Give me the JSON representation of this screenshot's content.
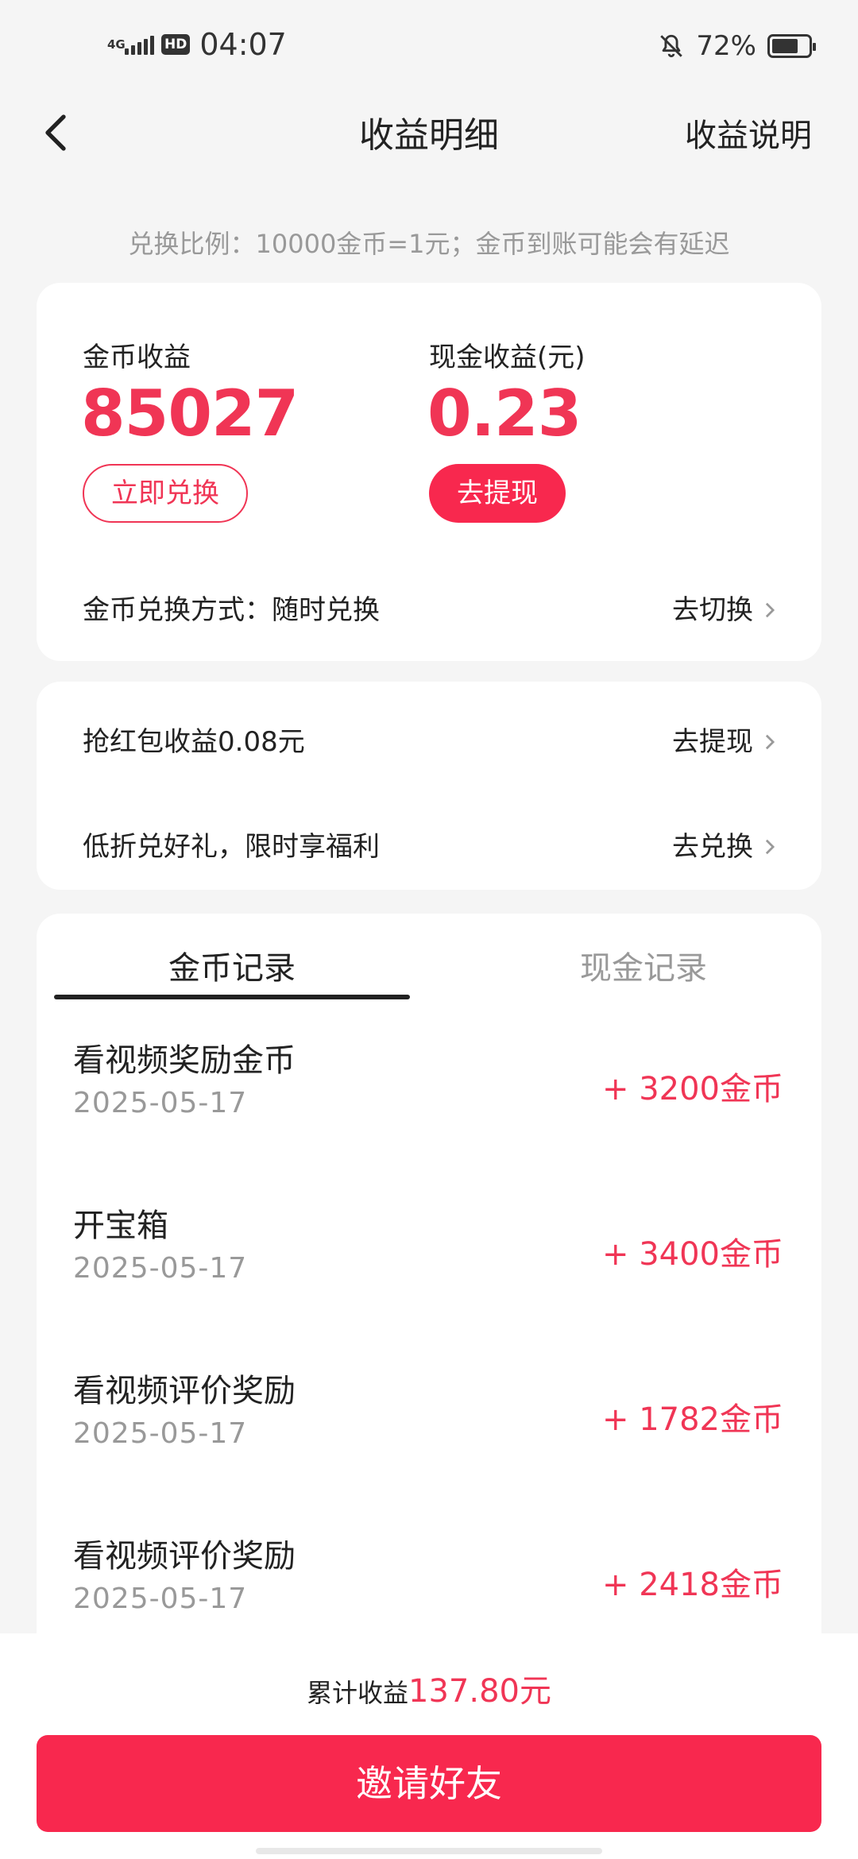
{
  "status": {
    "network": "4G",
    "hd": "HD",
    "time": "04:07",
    "battery": "72%",
    "battery_level": 0.72
  },
  "nav": {
    "title": "收益明细",
    "right_link": "收益说明"
  },
  "ratio_note": "兑换比例：10000金币=1元；金币到账可能会有延迟",
  "earnings": {
    "coin_label": "金币收益",
    "coin_value": "85027",
    "coin_button": "立即兑换",
    "cash_label": "现金收益(元)",
    "cash_value": "0.23",
    "cash_button": "去提现",
    "exchange_mode_label": "金币兑换方式：随时兑换",
    "exchange_mode_action": "去切换"
  },
  "promos": [
    {
      "label": "抢红包收益0.08元",
      "action": "去提现"
    },
    {
      "label": "低折兑好礼，限时享福利",
      "action": "去兑换"
    }
  ],
  "tabs": {
    "coin": "金币记录",
    "cash": "现金记录"
  },
  "records": [
    {
      "title": "看视频奖励金币",
      "date": "2025-05-17",
      "amount": "+ 3200金币"
    },
    {
      "title": "开宝箱",
      "date": "2025-05-17",
      "amount": "+ 3400金币"
    },
    {
      "title": "看视频评价奖励",
      "date": "2025-05-17",
      "amount": "+ 1782金币"
    },
    {
      "title": "看视频评价奖励",
      "date": "2025-05-17",
      "amount": "+ 2418金币"
    }
  ],
  "footer": {
    "total_label": "累计收益",
    "total_amount": "137.80元",
    "invite_button": "邀请好友"
  },
  "colors": {
    "accent": "#f8284e",
    "accent_text": "#f03555",
    "background": "#f5f5f5"
  },
  "icons": {
    "back": "back-arrow-icon",
    "chevron": "chevron-right-icon",
    "bell_off": "bell-off-icon",
    "signal": "signal-icon",
    "battery": "battery-icon"
  }
}
